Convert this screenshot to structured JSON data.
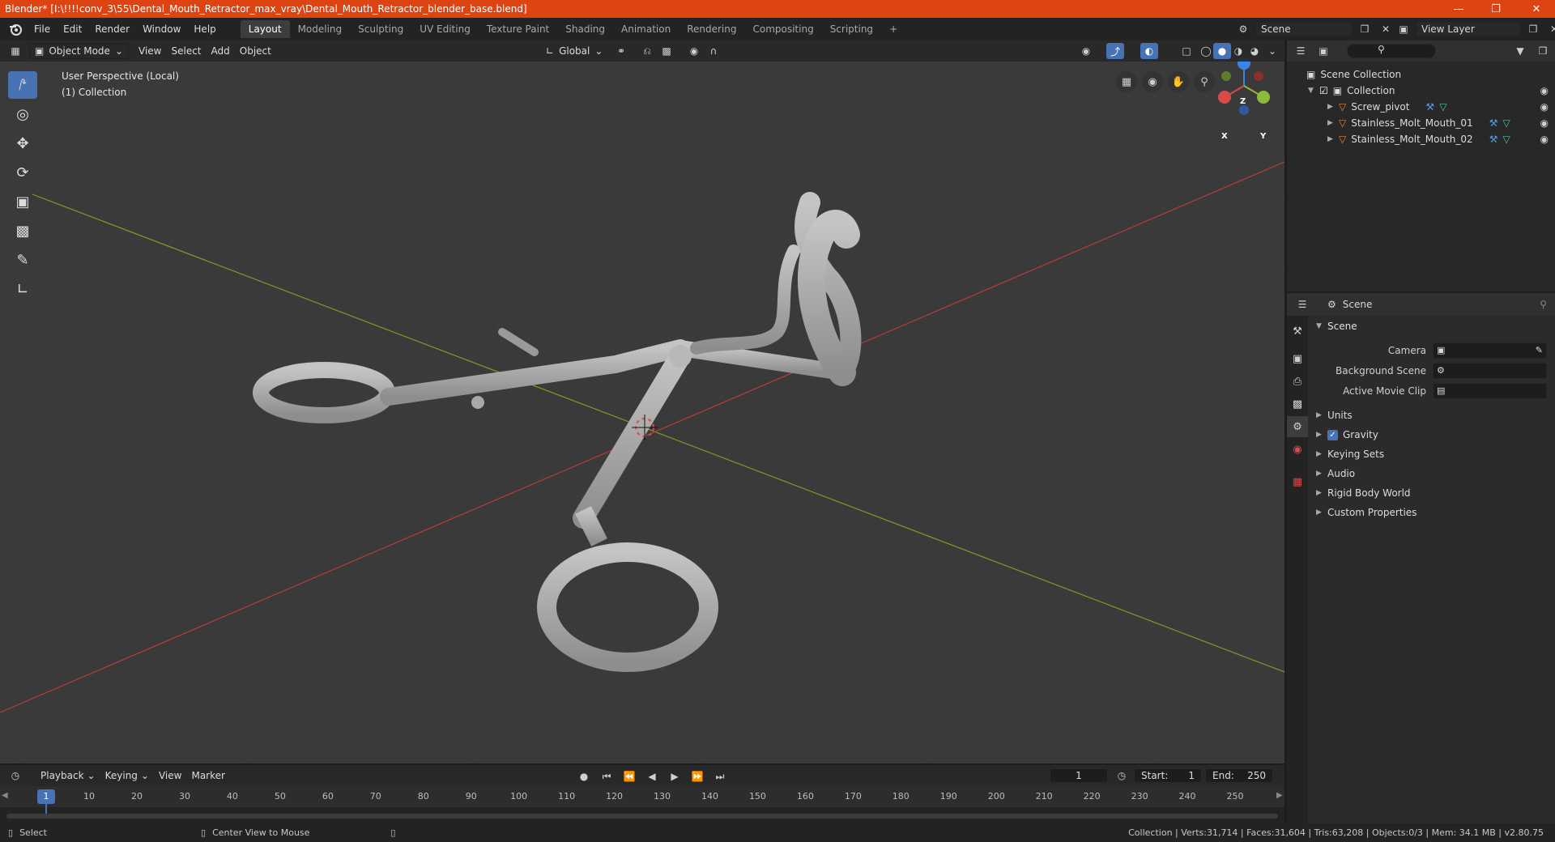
{
  "window": {
    "title": "Blender* [I:\\!!!!conv_3\\55\\Dental_Mouth_Retractor_max_vray\\Dental_Mouth_Retractor_blender_base.blend]",
    "controls": [
      "minimize-icon",
      "restore-icon",
      "close-icon"
    ],
    "title_bar_color": "#dd4411"
  },
  "menu": {
    "items": [
      "File",
      "Edit",
      "Render",
      "Window",
      "Help"
    ]
  },
  "workspaces": {
    "tabs": [
      "Layout",
      "Modeling",
      "Sculpting",
      "UV Editing",
      "Texture Paint",
      "Shading",
      "Animation",
      "Rendering",
      "Compositing",
      "Scripting"
    ],
    "active": "Layout",
    "add": "+"
  },
  "scene_selector": {
    "value": "Scene"
  },
  "view_layer": {
    "value": "View Layer"
  },
  "viewport_header": {
    "mode": "Object Mode",
    "menus": [
      "View",
      "Select",
      "Add",
      "Object"
    ],
    "transform_orientation": "Global"
  },
  "viewport": {
    "perspective": "User Perspective (Local)",
    "collection": "(1) Collection",
    "gizmo": {
      "x": "X",
      "y": "Y",
      "z": "Z"
    },
    "background_color": "#3a3a3a"
  },
  "outliner": {
    "search_placeholder": "",
    "root": "Scene Collection",
    "collection": "Collection",
    "objects": [
      "Screw_pivot",
      "Stainless_Molt_Mouth_01",
      "Stainless_Molt_Mouth_02"
    ]
  },
  "properties": {
    "context": "Scene",
    "panel": "Scene",
    "fields": [
      {
        "label": "Camera",
        "value": ""
      },
      {
        "label": "Background Scene",
        "value": ""
      },
      {
        "label": "Active Movie Clip",
        "value": ""
      }
    ],
    "sections": [
      "Units",
      "Gravity",
      "Keying Sets",
      "Audio",
      "Rigid Body World",
      "Custom Properties"
    ],
    "gravity_checked": true
  },
  "timeline": {
    "menus": [
      "Playback",
      "Keying",
      "View",
      "Marker"
    ],
    "current_frame": "1",
    "start_label": "Start:",
    "start": "1",
    "end_label": "End:",
    "end": "250",
    "ticks": [
      "1",
      "10",
      "20",
      "30",
      "40",
      "50",
      "60",
      "70",
      "80",
      "90",
      "100",
      "110",
      "120",
      "130",
      "140",
      "150",
      "160",
      "170",
      "180",
      "190",
      "200",
      "210",
      "220",
      "230",
      "240",
      "250"
    ]
  },
  "statusbar": {
    "left_action": "Select",
    "middle_action": "Center View to Mouse",
    "stats": "Collection | Verts:31,714 | Faces:31,604 | Tris:63,208 | Objects:0/3 | Mem: 34.1 MB | v2.80.75"
  },
  "colors": {
    "accent": "#4772b3",
    "axis_x": "#d84a4a",
    "axis_y": "#8cba3a",
    "axis_z": "#3a86e8"
  }
}
